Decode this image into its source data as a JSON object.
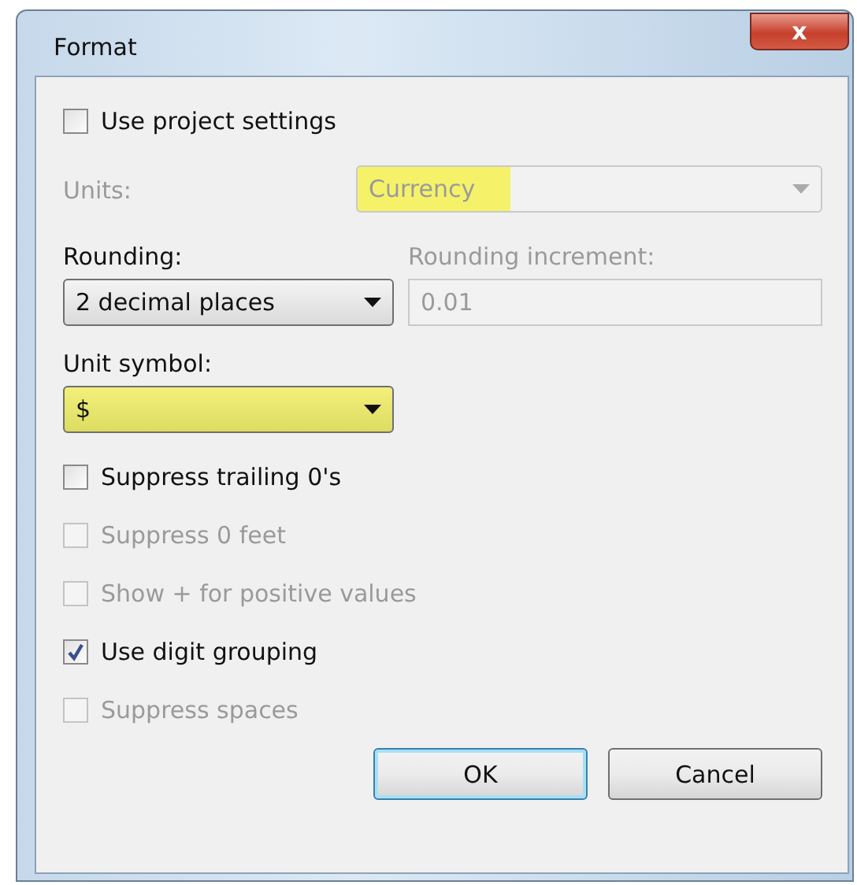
{
  "window": {
    "title": "Format",
    "close": "x"
  },
  "use_project_settings": {
    "label": "Use project settings",
    "checked": false,
    "disabled": false
  },
  "units": {
    "label": "Units:",
    "value": "Currency",
    "disabled": true,
    "highlighted": true
  },
  "rounding": {
    "label": "Rounding:",
    "value": "2 decimal places",
    "disabled": false,
    "highlighted": false
  },
  "rounding_increment": {
    "label": "Rounding increment:",
    "value": "0.01",
    "disabled": true
  },
  "unit_symbol": {
    "label": "Unit symbol:",
    "value": "$",
    "disabled": false,
    "highlighted": true
  },
  "options": [
    {
      "label": "Suppress trailing 0's",
      "checked": false,
      "disabled": false
    },
    {
      "label": "Suppress 0 feet",
      "checked": false,
      "disabled": true
    },
    {
      "label": "Show + for positive values",
      "checked": false,
      "disabled": true
    },
    {
      "label": "Use digit grouping",
      "checked": true,
      "disabled": false
    },
    {
      "label": "Suppress spaces",
      "checked": false,
      "disabled": true
    }
  ],
  "buttons": [
    {
      "label": "OK",
      "default": true
    },
    {
      "label": "Cancel",
      "default": false
    }
  ]
}
